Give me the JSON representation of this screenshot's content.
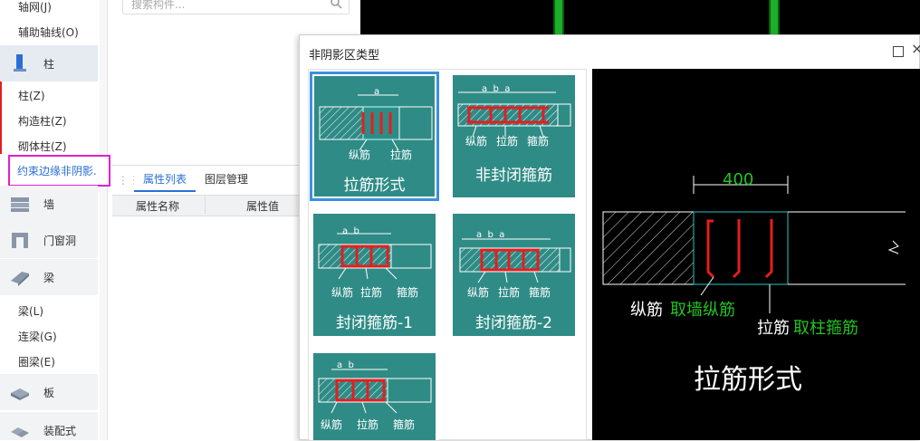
{
  "sidebar": {
    "items": {
      "axis_net": "轴网(J)",
      "aux_axis": "辅助轴线(O)",
      "cat_column": "柱",
      "column": "柱(Z)",
      "struct_column": "构造柱(Z)",
      "masonry_column": "砌体柱(Z)",
      "constraint_edge": "约束边缘非阴影.",
      "cat_wall": "墙",
      "cat_door_window": "门窗洞",
      "cat_beam": "梁",
      "beam": "梁(L)",
      "link_beam": "连梁(G)",
      "ring_beam": "圈梁(E)",
      "cat_slab": "板",
      "cat_prefab": "装配式"
    }
  },
  "panel": {
    "search_placeholder": "搜索构件...",
    "tab_props": "属性列表",
    "tab_layers": "图层管理",
    "col_name": "属性名称",
    "col_value": "属性值"
  },
  "dialog": {
    "title": "非阴影区类型",
    "maximize_icon": "□",
    "close_icon": "×",
    "options": [
      {
        "caption": "拉筋形式",
        "dims": "a",
        "labels": [
          "纵筋",
          "拉筋"
        ]
      },
      {
        "caption": "非封闭箍筋",
        "dims": "a  b  a",
        "labels": [
          "纵筋",
          "拉筋",
          "箍筋"
        ]
      },
      {
        "caption": "封闭箍筋-1",
        "dims": "a  b",
        "labels": [
          "纵筋",
          "拉筋",
          "箍筋"
        ]
      },
      {
        "caption": "封闭箍筋-2",
        "dims": "a  b  a",
        "labels": [
          "纵筋",
          "拉筋",
          "箍筋"
        ]
      },
      {
        "caption": "",
        "dims": "a  b",
        "labels": [
          "纵筋",
          "拉筋",
          "箍筋"
        ]
      }
    ],
    "preview": {
      "dimension": "400",
      "longitudinal_label": "纵筋",
      "longitudinal_note": "取墙纵筋",
      "tie_label": "拉筋",
      "tie_note": "取柱箍筋",
      "title": "拉筋形式"
    }
  },
  "colors": {
    "accent": "#2b6fd6",
    "tile_teal": "#2f8b86",
    "rebar_red": "#e41e1e",
    "cad_green": "#22c322",
    "highlight_magenta": "#e020d0"
  }
}
